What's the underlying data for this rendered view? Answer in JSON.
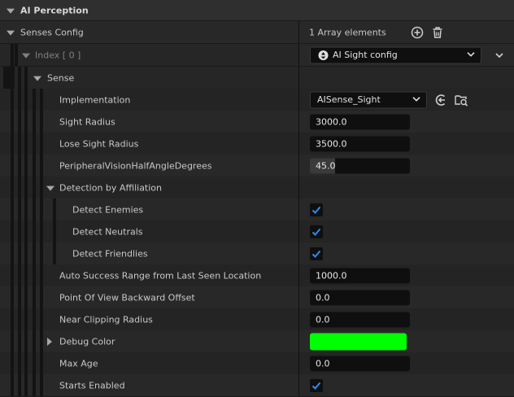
{
  "section": {
    "title": "AI Perception"
  },
  "senses_config": {
    "label": "Senses Config",
    "array_count": "1 Array elements",
    "index_label": "Index [ 0 ]",
    "config_selected": "AI Sight config"
  },
  "sense": {
    "label": "Sense",
    "implementation": {
      "label": "Implementation",
      "value": "AISense_Sight"
    },
    "sight_radius": {
      "label": "Sight Radius",
      "value": "3000.0"
    },
    "lose_sight_radius": {
      "label": "Lose Sight Radius",
      "value": "3500.0"
    },
    "peripheral": {
      "label": "PeripheralVisionHalfAngleDegrees",
      "value": "45.0",
      "fraction": 0.25
    },
    "detection": {
      "label": "Detection by Affiliation",
      "enemies": {
        "label": "Detect Enemies",
        "checked": true
      },
      "neutrals": {
        "label": "Detect Neutrals",
        "checked": true
      },
      "friendlies": {
        "label": "Detect Friendlies",
        "checked": true
      }
    },
    "auto_success": {
      "label": "Auto Success Range from Last Seen Location",
      "value": "1000.0"
    },
    "pov_offset": {
      "label": "Point Of View Backward Offset",
      "value": "0.0"
    },
    "near_clip": {
      "label": "Near Clipping Radius",
      "value": "0.0"
    },
    "debug_color": {
      "label": "Debug Color",
      "color": "#00ff00"
    },
    "max_age": {
      "label": "Max Age",
      "value": "0.0"
    },
    "starts_enabled": {
      "label": "Starts Enabled",
      "checked": true
    }
  },
  "colors": {
    "check": "#2c8cf2",
    "accent_icon": "#cfcfcf"
  }
}
